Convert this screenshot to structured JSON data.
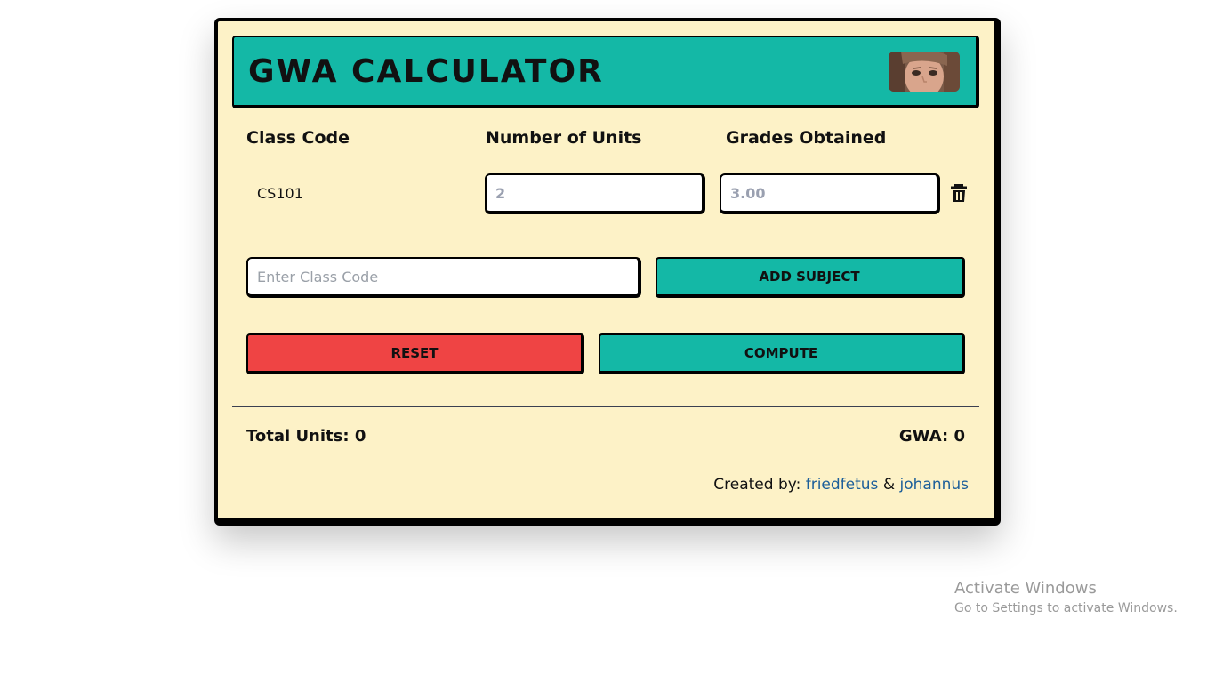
{
  "header": {
    "title": "GWA CALCULATOR"
  },
  "columns": {
    "class_code": "Class Code",
    "units": "Number of Units",
    "grades": "Grades Obtained"
  },
  "subjects": [
    {
      "class_code": "CS101",
      "units_placeholder": "2",
      "grade_placeholder": "3.00"
    }
  ],
  "add_form": {
    "class_code_placeholder": "Enter Class Code",
    "add_label": "ADD SUBJECT"
  },
  "actions": {
    "reset_label": "RESET",
    "compute_label": "COMPUTE"
  },
  "summary": {
    "total_units": "Total Units: 0",
    "gwa": "GWA: 0"
  },
  "credits": {
    "prefix": "Created by:",
    "author1": "friedfetus",
    "separator": "&",
    "author2": "johannus"
  },
  "watermark": {
    "title": "Activate Windows",
    "subtitle": "Go to Settings to activate Windows."
  },
  "colors": {
    "card_bg": "#fdf2c7",
    "accent": "#14b8a6",
    "danger": "#ef4444",
    "link": "#1d5f9a"
  },
  "icons": {
    "delete": "trash-icon"
  }
}
